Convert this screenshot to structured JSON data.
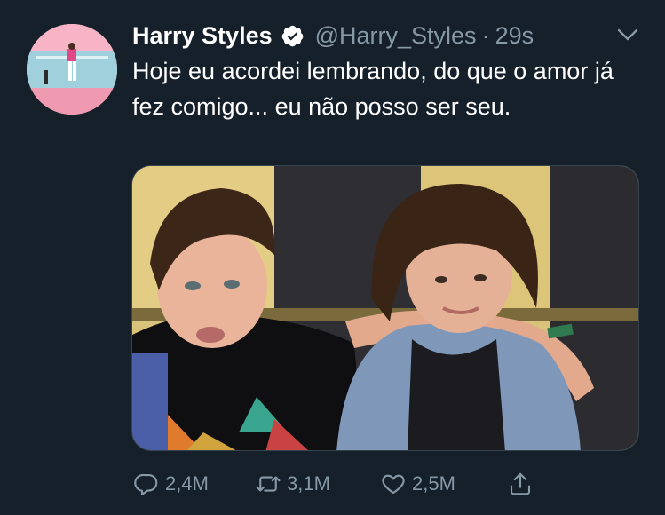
{
  "tweet": {
    "author": {
      "display_name": "Harry Styles",
      "handle": "@Harry_Styles",
      "verified": true,
      "avatar_icon": "avatar-photo"
    },
    "separator": "·",
    "time": "29s",
    "text": "Hoje eu acordei lembrando, do que o amor já fez comigo... eu não posso ser seu.",
    "media": {
      "type": "photo"
    },
    "actions": {
      "reply": {
        "icon": "reply-icon",
        "count": "2,4M"
      },
      "retweet": {
        "icon": "retweet-icon",
        "count": "3,1M"
      },
      "like": {
        "icon": "heart-icon",
        "count": "2,5M"
      },
      "share": {
        "icon": "share-icon"
      }
    },
    "colors": {
      "background": "#15202b",
      "secondary_text": "#8899a6",
      "verified_badge": "#ffffff"
    }
  }
}
